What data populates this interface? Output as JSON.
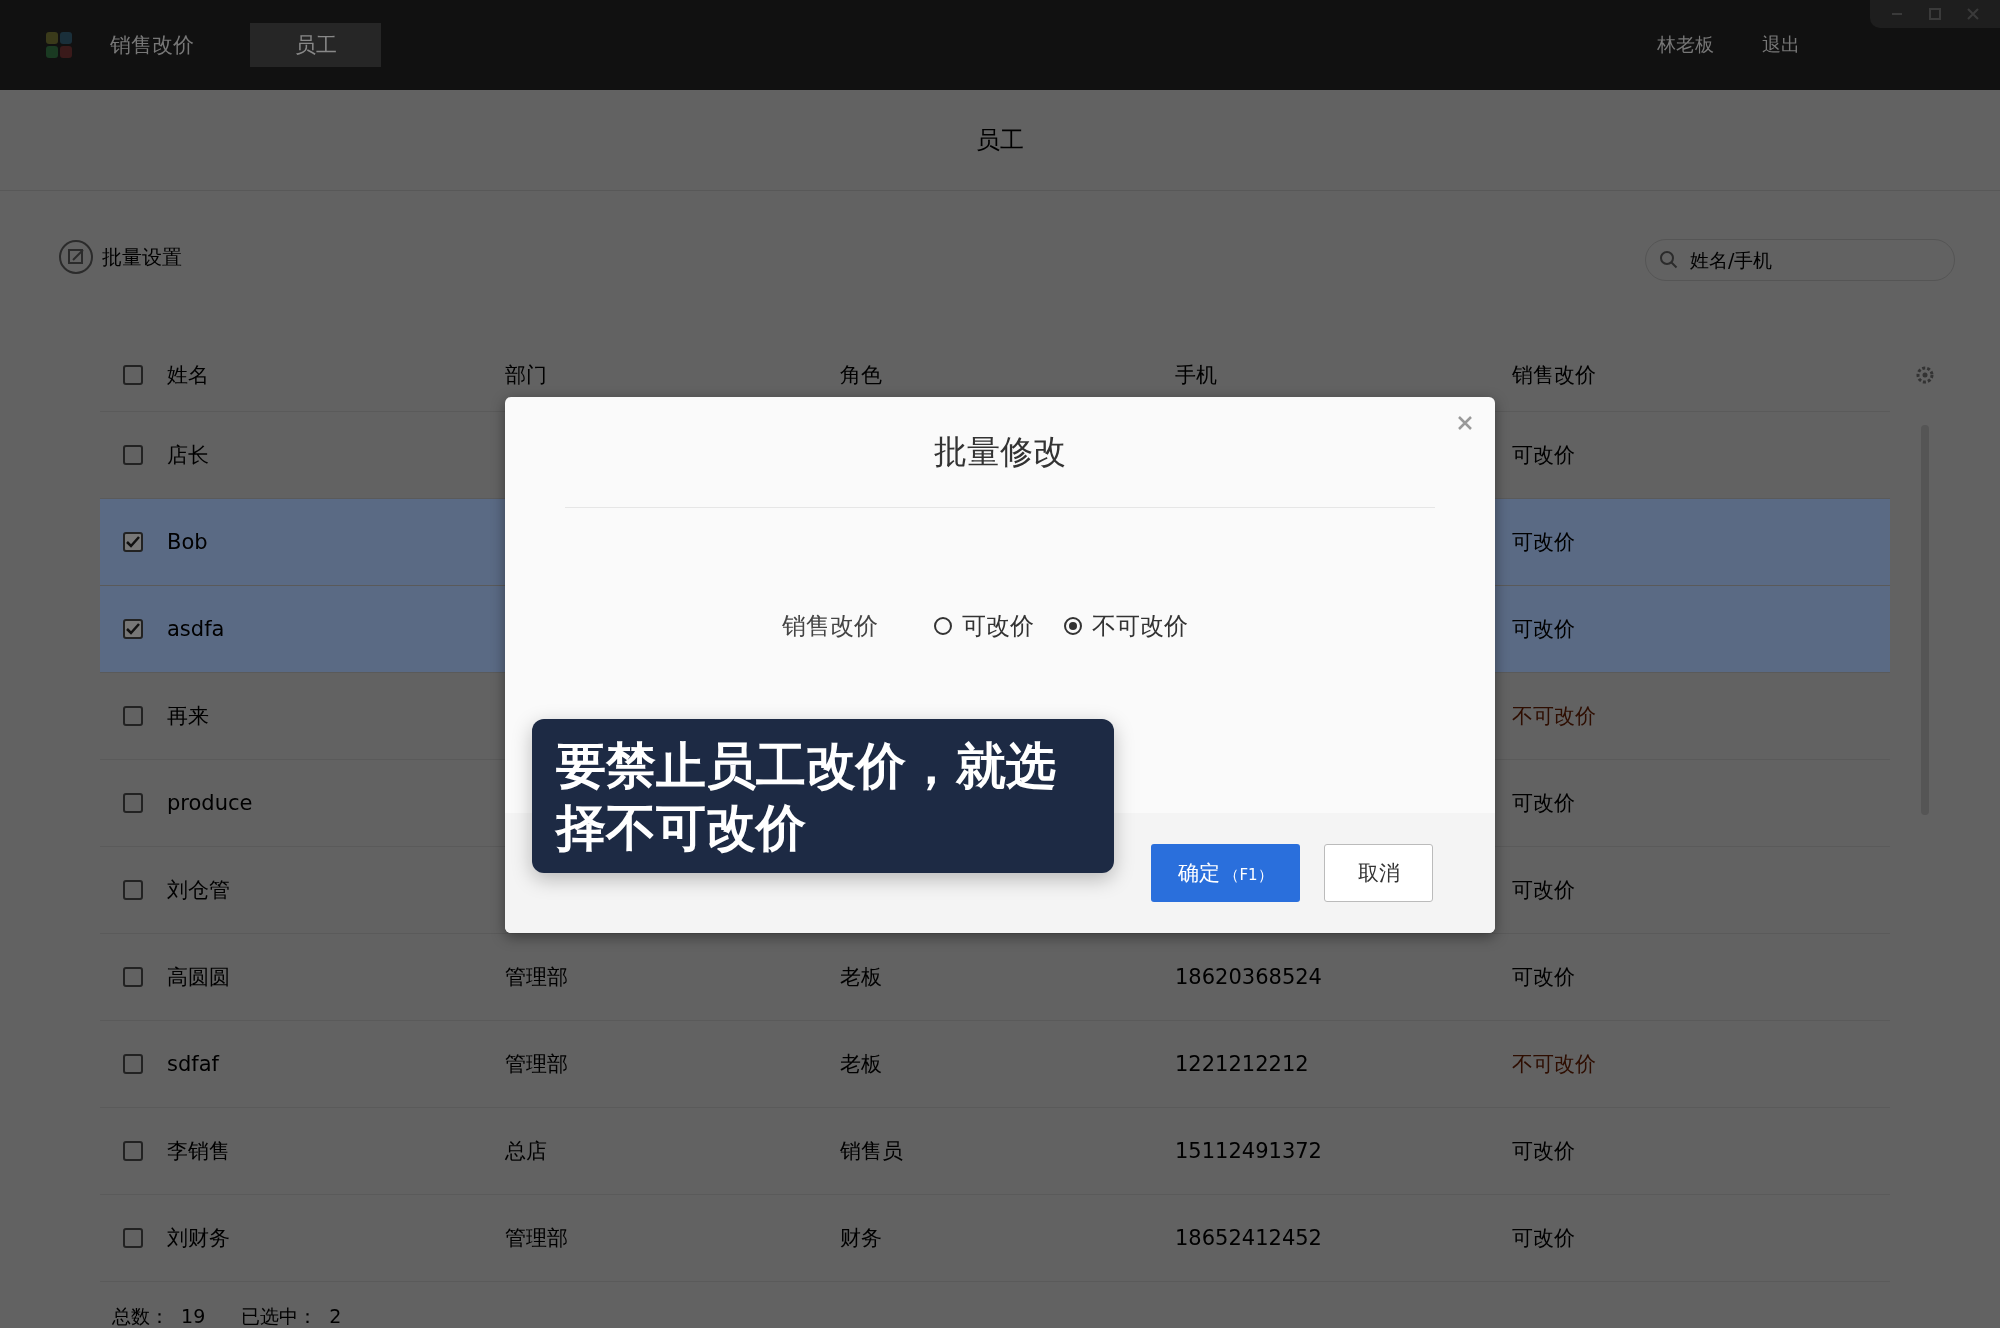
{
  "app": {
    "name": "销售改价"
  },
  "nav_tabs": [
    {
      "label": "员工",
      "selected": true
    }
  ],
  "user": {
    "name": "林老板",
    "logout": "退出"
  },
  "page": {
    "title": "员工"
  },
  "toolbar": {
    "batch_button": "批量设置",
    "search": {
      "placeholder": "姓名/手机"
    }
  },
  "table": {
    "select_all": false,
    "columns": [
      "姓名",
      "部门",
      "角色",
      "手机",
      "销售改价"
    ],
    "rows": [
      {
        "name": "店长",
        "selected": false,
        "price": "可改价",
        "price_allowed": true
      },
      {
        "name": "Bob",
        "selected": true,
        "price": "可改价",
        "price_allowed": true
      },
      {
        "name": "asdfa",
        "selected": true,
        "price": "可改价",
        "price_allowed": true
      },
      {
        "name": "再来",
        "selected": false,
        "price": "不可改价",
        "price_allowed": false
      },
      {
        "name": "produce",
        "selected": false,
        "price": "可改价",
        "price_allowed": true
      },
      {
        "name": "刘仓管",
        "selected": false,
        "price": "可改价",
        "price_allowed": true
      },
      {
        "name": "高圆圆",
        "selected": false,
        "dept": "管理部",
        "role": "老板",
        "phone": "18620368524",
        "price": "可改价",
        "price_allowed": true
      },
      {
        "name": "sdfaf",
        "selected": false,
        "dept": "管理部",
        "role": "老板",
        "phone": "1221212212",
        "price": "不可改价",
        "price_allowed": false
      },
      {
        "name": "李销售",
        "selected": false,
        "dept": "总店",
        "role": "销售员",
        "phone": "15112491372",
        "price": "可改价",
        "price_allowed": true
      },
      {
        "name": "刘财务",
        "selected": false,
        "dept": "管理部",
        "role": "财务",
        "phone": "18652412452",
        "price": "可改价",
        "price_allowed": true
      }
    ]
  },
  "footer": {
    "total_label": "总数：",
    "total": "19",
    "selected_label": "已选中：",
    "selected_count": "2"
  },
  "dialog": {
    "title": "批量修改",
    "field_label": "销售改价",
    "options": [
      {
        "label": "可改价",
        "selected": false
      },
      {
        "label": "不可改价",
        "selected": true
      }
    ],
    "confirm": "确定",
    "confirm_key": "（F1）",
    "cancel": "取消"
  },
  "tooltip": {
    "text": "要禁止员工改价，就选择不可改价"
  }
}
